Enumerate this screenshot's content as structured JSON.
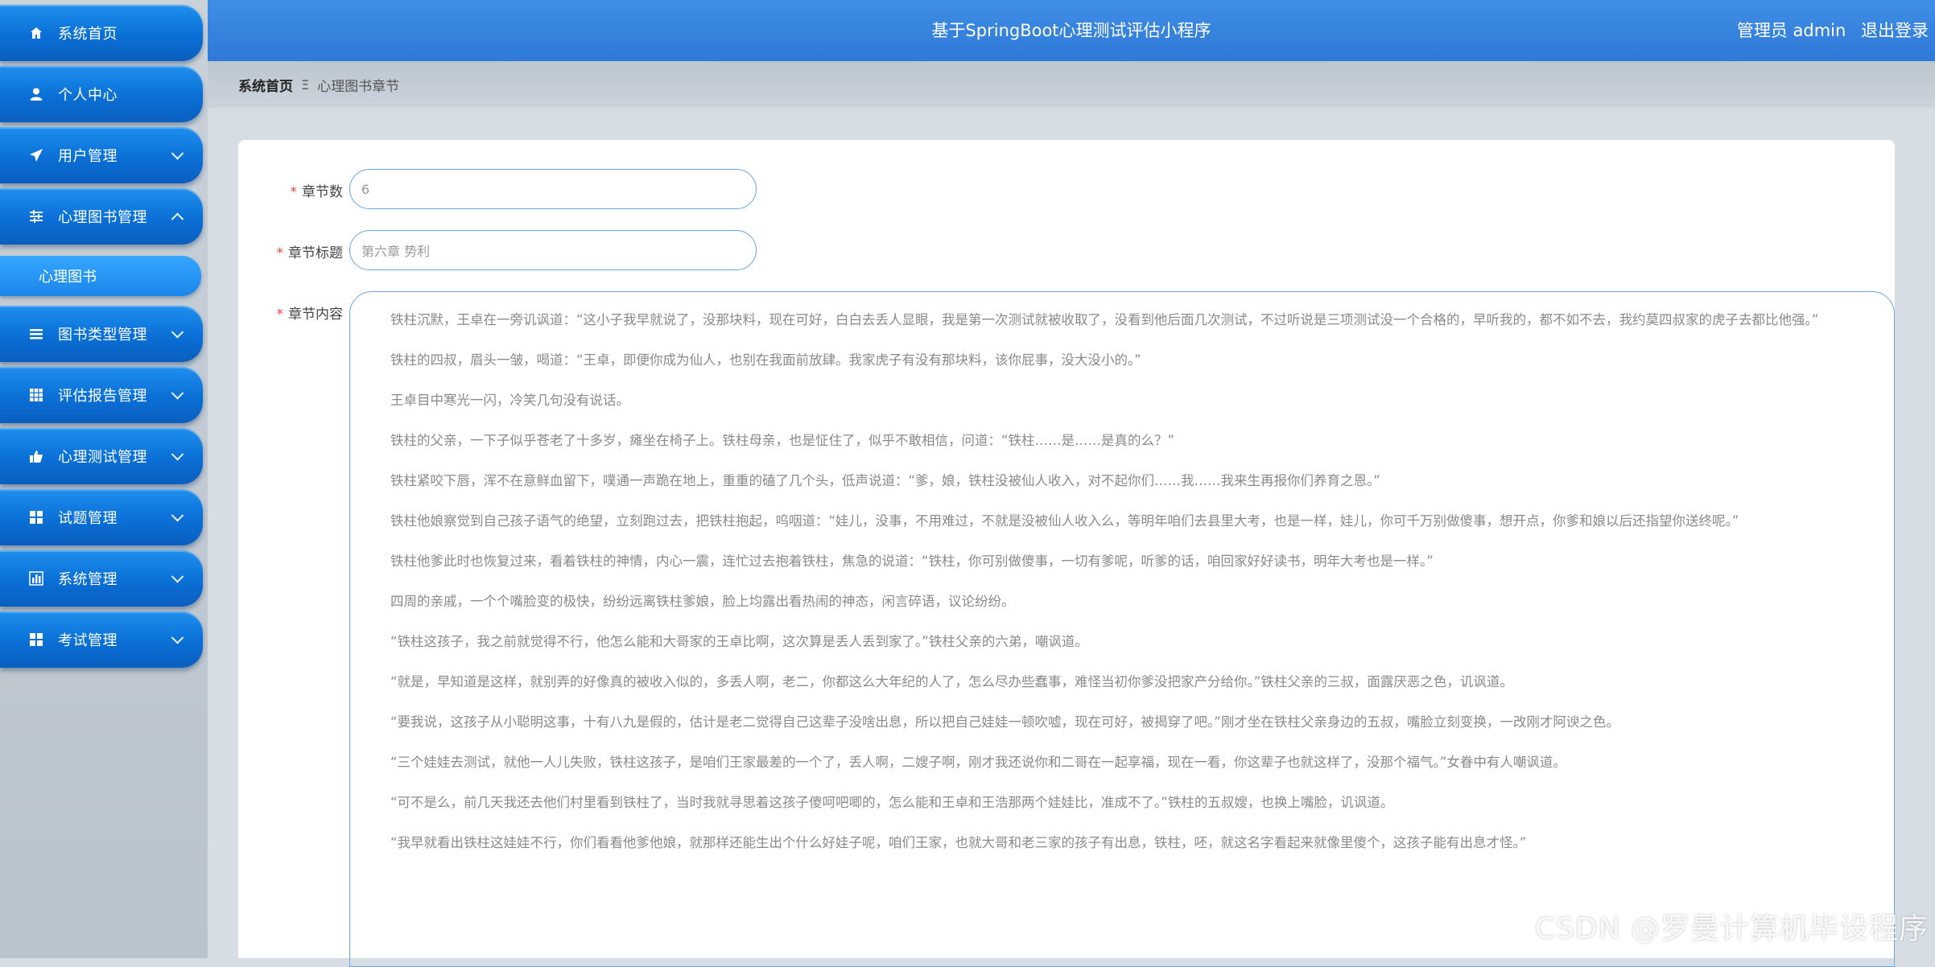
{
  "header": {
    "title": "基于SpringBoot心理测试评估小程序",
    "user_label": "管理员 admin",
    "logout_label": "退出登录"
  },
  "sidebar": {
    "items": [
      {
        "label": "系统首页",
        "icon": "home-icon"
      },
      {
        "label": "个人中心",
        "icon": "user-icon"
      },
      {
        "label": "用户管理",
        "icon": "send-icon"
      },
      {
        "label": "心理图书管理",
        "icon": "sliders-icon"
      },
      {
        "label": "图书类型管理",
        "icon": "list-icon"
      },
      {
        "label": "评估报告管理",
        "icon": "grid-icon"
      },
      {
        "label": "心理测试管理",
        "icon": "thumb-icon"
      },
      {
        "label": "试题管理",
        "icon": "grid-icon"
      },
      {
        "label": "系统管理",
        "icon": "chart-icon"
      },
      {
        "label": "考试管理",
        "icon": "grid-icon"
      }
    ],
    "active_sub_item": "心理图书"
  },
  "breadcrumb": {
    "home": "系统首页",
    "separator": "Ξ",
    "current": "心理图书章节"
  },
  "form": {
    "chapter_num_label": "章节数",
    "chapter_num_value": "6",
    "chapter_title_label": "章节标题",
    "chapter_title_value": "第六章 势利",
    "chapter_content_label": "章节内容",
    "required_mark": "*",
    "paragraphs": [
      "铁柱沉默，王卓在一旁讥讽道：“这小子我早就说了，没那块料，现在可好，白白去丢人显眼，我是第一次测试就被收取了，没看到他后面几次测试，不过听说是三项测试没一个合格的，早听我的，都不如不去，我约莫四叔家的虎子去都比他强。”",
      "铁柱的四叔，眉头一皱，喝道：“王卓，即便你成为仙人，也别在我面前放肆。我家虎子有没有那块料，该你屁事，没大没小的。”",
      "王卓目中寒光一闪，冷笑几句没有说话。",
      "铁柱的父亲，一下子似乎苍老了十多岁，瘫坐在椅子上。铁柱母亲，也是怔住了，似乎不敢相信，问道：“铁柱……是……是真的么？”",
      "铁柱紧咬下唇，浑不在意鲜血留下，噗通一声跪在地上，重重的磕了几个头，低声说道：“爹，娘，铁柱没被仙人收入，对不起你们……我……我来生再报你们养育之恩。”",
      "铁柱他娘察觉到自己孩子语气的绝望，立刻跑过去，把铁柱抱起，呜咽道：“娃儿，没事，不用难过，不就是没被仙人收入么，等明年咱们去县里大考，也是一样，娃儿，你可千万别做傻事，想开点，你爹和娘以后还指望你送终呢。”",
      "铁柱他爹此时也恢复过来，看着铁柱的神情，内心一震，连忙过去抱着铁柱，焦急的说道：“铁柱，你可别做傻事，一切有爹呢，听爹的话，咱回家好好读书，明年大考也是一样。”",
      "四周的亲戚，一个个嘴脸变的极快，纷纷远离铁柱爹娘，脸上均露出看热闹的神态，闲言碎语，议论纷纷。",
      "“铁柱这孩子，我之前就觉得不行，他怎么能和大哥家的王卓比啊，这次算是丢人丢到家了。”铁柱父亲的六弟，嘲讽道。",
      "“就是，早知道是这样，就别弄的好像真的被收入似的，多丢人啊，老二，你都这么大年纪的人了，怎么尽办些蠢事，难怪当初你爹没把家产分给你。”铁柱父亲的三叔，面露厌恶之色，讥讽道。",
      "“要我说，这孩子从小聪明这事，十有八九是假的，估计是老二觉得自己这辈子没啥出息，所以把自己娃娃一顿吹嘘，现在可好，被揭穿了吧。”刚才坐在铁柱父亲身边的五叔，嘴脸立刻变换，一改刚才阿谀之色。",
      "“三个娃娃去测试，就他一人儿失败，铁柱这孩子，是咱们王家最差的一个了，丢人啊，二嫂子啊，刚才我还说你和二哥在一起享福，现在一看，你这辈子也就这样了，没那个福气。”女眷中有人嘲讽道。",
      "“可不是么，前几天我还去他们村里看到铁柱了，当时我就寻思着这孩子傻呵吧唧的，怎么能和王卓和王浩那两个娃娃比，准成不了。”铁柱的五叔嫂，也换上嘴脸，讥讽道。",
      "“我早就看出铁柱这娃娃不行，你们看看他爹他娘，就那样还能生出个什么好娃子呢，咱们王家，也就大哥和老三家的孩子有出息，铁柱，呸，就这名字看起来就像里傻个，这孩子能有出息才怪。”"
    ]
  },
  "watermark": "CSDN @罗曼计算机毕设程序"
}
